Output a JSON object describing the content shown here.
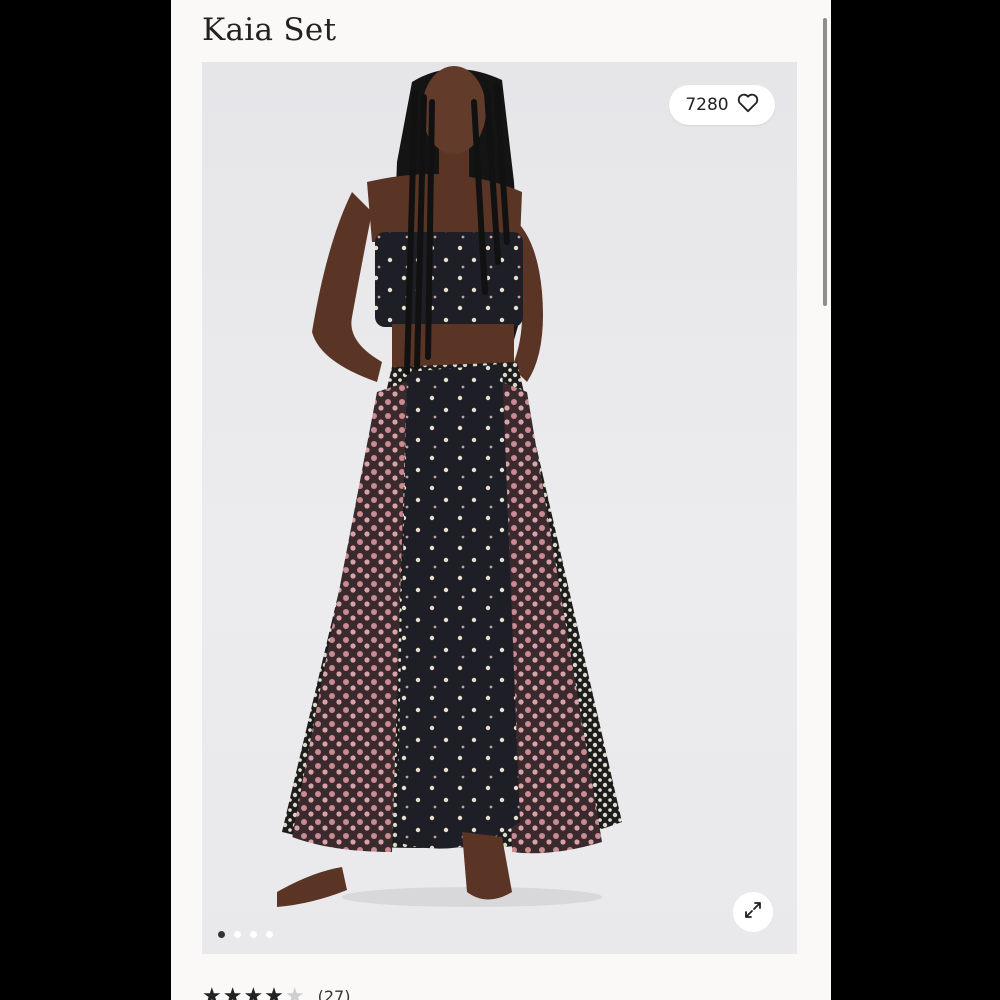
{
  "product": {
    "title": "Kaia Set",
    "favorites_count": "7280",
    "rating": 4,
    "rating_max": 5,
    "review_count": "(27)"
  },
  "gallery": {
    "image_count": 4,
    "active_index": 0
  },
  "icons": {
    "favorite": "heart-icon",
    "expand": "expand-icon"
  }
}
